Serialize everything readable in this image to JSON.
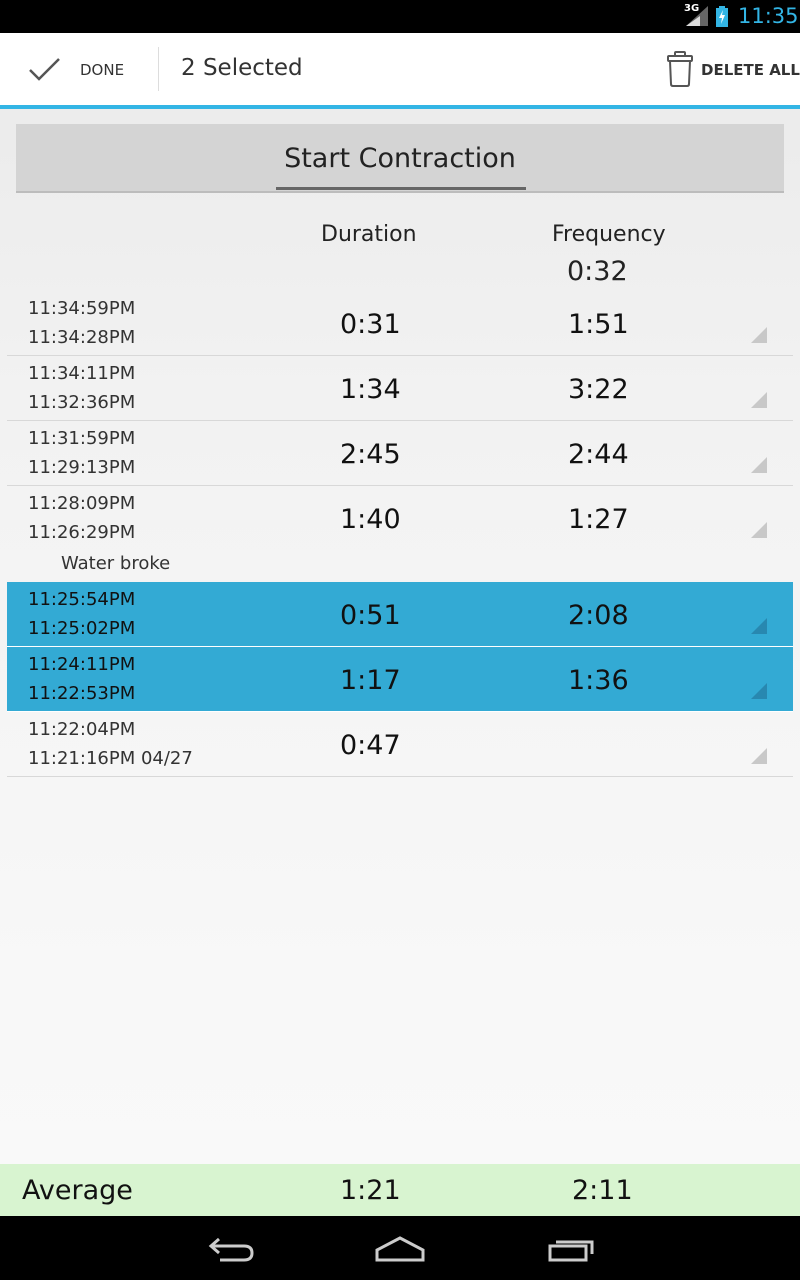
{
  "status_bar": {
    "network": "3G",
    "time": "11:35",
    "signal_icon": "signal-icon",
    "battery_icon": "battery-charging-icon",
    "accent": "#33b5e5"
  },
  "action_bar": {
    "done_label": "DONE",
    "selected_label": "2 Selected",
    "delete_all_label": "DELETE ALL",
    "done_icon": "checkmark-icon",
    "delete_icon": "trash-icon",
    "accent": "#33b5e5"
  },
  "start_button": {
    "label": "Start Contraction"
  },
  "table_header": {
    "duration": "Duration",
    "frequency": "Frequency",
    "current_frequency": "0:32"
  },
  "contractions": [
    {
      "end": "11:34:59PM",
      "start": "11:34:28PM",
      "duration": "0:31",
      "frequency": "1:51",
      "selected": false
    },
    {
      "end": "11:34:11PM",
      "start": "11:32:36PM",
      "duration": "1:34",
      "frequency": "3:22",
      "selected": false
    },
    {
      "end": "11:31:59PM",
      "start": "11:29:13PM",
      "duration": "2:45",
      "frequency": "2:44",
      "selected": false
    },
    {
      "end": "11:28:09PM",
      "start": "11:26:29PM",
      "duration": "1:40",
      "frequency": "1:27",
      "selected": false
    },
    {
      "end": "11:25:54PM",
      "start": "11:25:02PM",
      "duration": "0:51",
      "frequency": "2:08",
      "selected": true
    },
    {
      "end": "11:24:11PM",
      "start": "11:22:53PM",
      "duration": "1:17",
      "frequency": "1:36",
      "selected": true
    },
    {
      "end": "11:22:04PM",
      "start": "11:21:16PM 04/27",
      "duration": "0:47",
      "frequency": "",
      "selected": false
    }
  ],
  "note": "Water broke",
  "selected_color": "#33aad4",
  "average": {
    "label": "Average",
    "duration": "1:21",
    "frequency": "2:11",
    "color": "#d8f4d0"
  },
  "nav_bar": {
    "back_icon": "back-icon",
    "home_icon": "home-icon",
    "recents_icon": "recents-icon"
  }
}
